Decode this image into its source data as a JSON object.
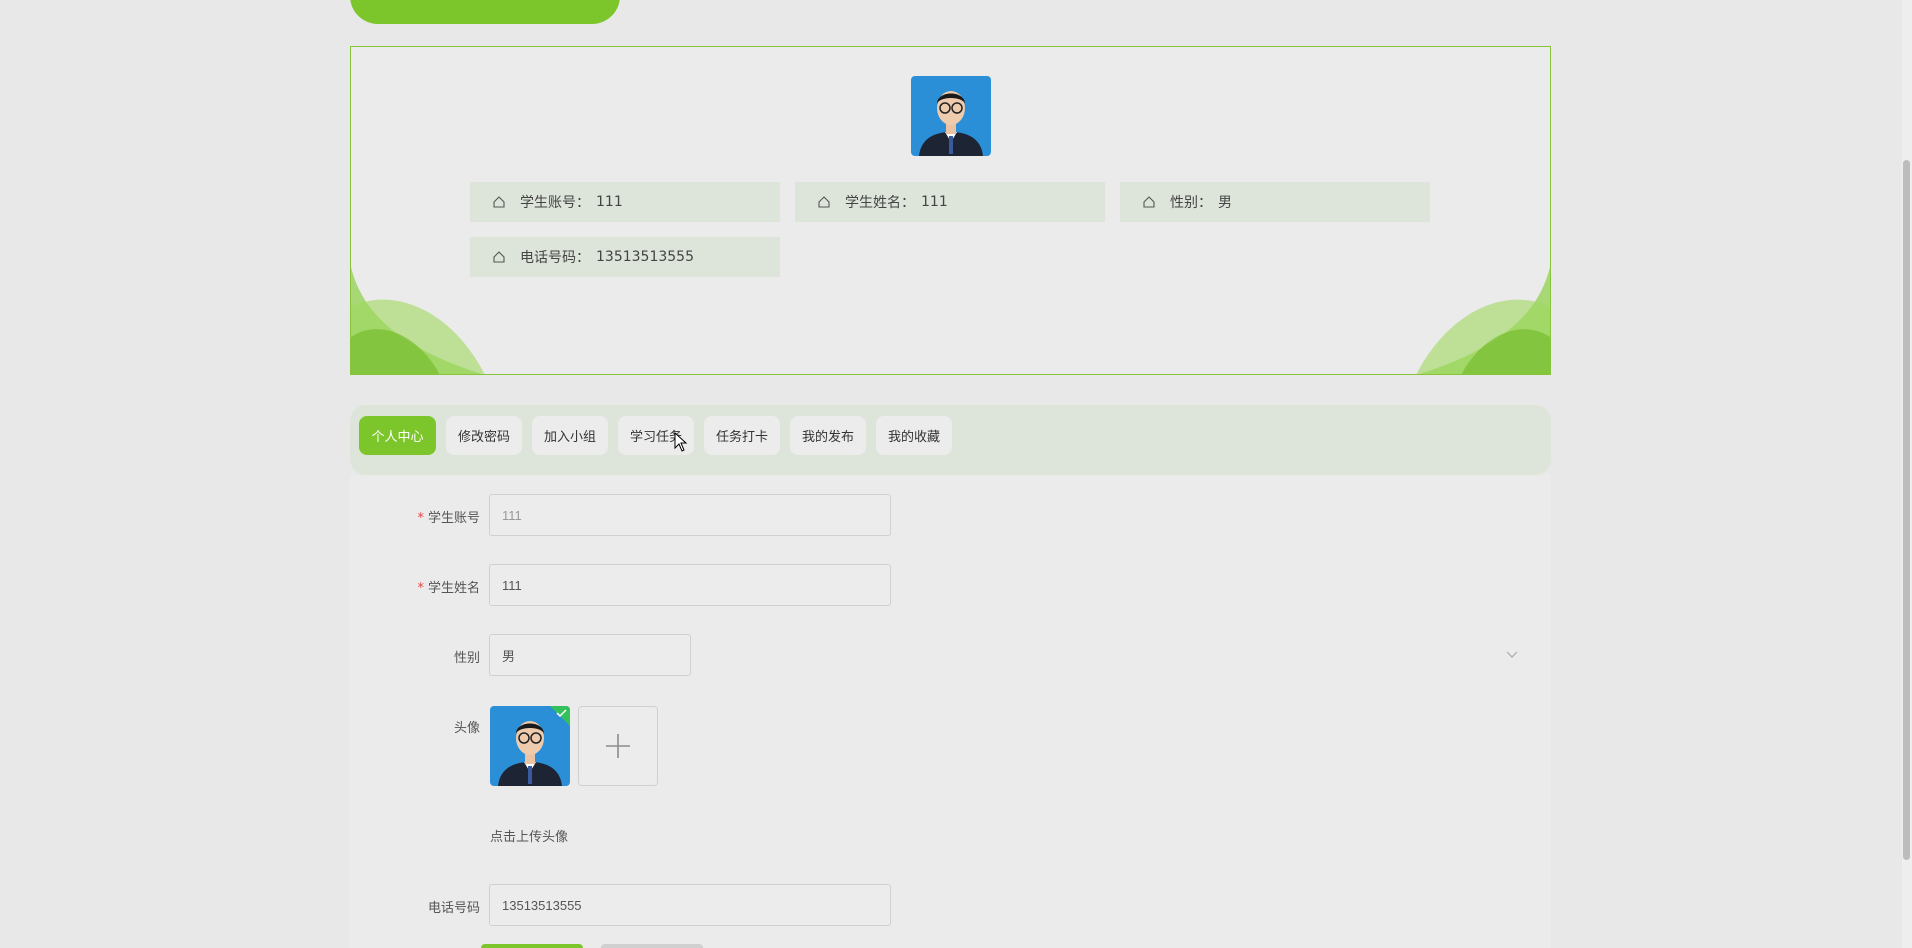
{
  "colors": {
    "accent": "#7cc52a",
    "info_bg": "#dde5db",
    "required": "#e04545"
  },
  "profile": {
    "info": [
      {
        "label": "学生账号：",
        "value": "111",
        "icon": "home-icon"
      },
      {
        "label": "学生姓名：",
        "value": "111",
        "icon": "home-icon"
      },
      {
        "label": "性别：",
        "value": "男",
        "icon": "home-icon"
      },
      {
        "label": "电话号码：",
        "value": "13513513555",
        "icon": "home-icon"
      }
    ]
  },
  "tabs": [
    {
      "label": "个人中心",
      "active": true
    },
    {
      "label": "修改密码",
      "active": false
    },
    {
      "label": "加入小组",
      "active": false
    },
    {
      "label": "学习任务",
      "active": false
    },
    {
      "label": "任务打卡",
      "active": false
    },
    {
      "label": "我的发布",
      "active": false
    },
    {
      "label": "我的收藏",
      "active": false
    }
  ],
  "form": {
    "account": {
      "label": "学生账号",
      "required": true,
      "value": "111"
    },
    "name": {
      "label": "学生姓名",
      "required": true,
      "value": "111"
    },
    "gender": {
      "label": "性别",
      "value": "男"
    },
    "avatar": {
      "label": "头像",
      "hint": "点击上传头像"
    },
    "phone": {
      "label": "电话号码",
      "value": "13513513555"
    }
  }
}
